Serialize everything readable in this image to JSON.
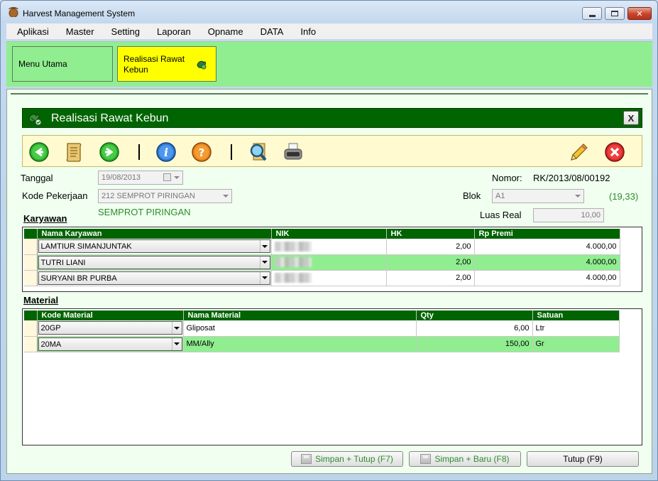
{
  "window": {
    "title": "Harvest Management System"
  },
  "menu": [
    "Aplikasi",
    "Master",
    "Setting",
    "Laporan",
    "Opname",
    "DATA",
    "Info"
  ],
  "nav_tabs": {
    "main": "Menu Utama",
    "active": "Realisasi Rawat Kebun"
  },
  "form": {
    "title": "Realisasi Rawat Kebun",
    "close_label": "X",
    "tanggal_label": "Tanggal",
    "tanggal_value": "19/08/2013",
    "nomor_label": "Nomor:",
    "nomor_value": "RK/2013/08/00192",
    "kode_pekerjaan_label": "Kode Pekerjaan",
    "kode_pekerjaan_value": "212 SEMPROT PIRINGAN",
    "pekerjaan_name": "SEMPROT PIRINGAN",
    "blok_label": "Blok",
    "blok_value": "A1",
    "blok_area": "(19,33)",
    "luas_real_label": "Luas Real",
    "luas_real_value": "10,00"
  },
  "karyawan": {
    "section_title": "Karyawan",
    "columns": [
      "Nama Karyawan",
      "NIK",
      "HK",
      "Rp Premi"
    ],
    "rows": [
      {
        "nama": "LAMTIUR SIMANJUNTAK",
        "hk": "2,00",
        "premi": "4.000,00"
      },
      {
        "nama": "TUTRI LIANI",
        "hk": "2,00",
        "premi": "4.000,00"
      },
      {
        "nama": "SURYANI BR PURBA",
        "hk": "2,00",
        "premi": "4.000,00"
      }
    ]
  },
  "material": {
    "section_title": "Material",
    "columns": [
      "Kode Material",
      "Nama Material",
      "Qty",
      "Satuan"
    ],
    "rows": [
      {
        "kode": "20GP",
        "nama": "Gliposat",
        "qty": "6,00",
        "satuan": "Ltr"
      },
      {
        "kode": "20MA",
        "nama": "MM/Ally",
        "qty": "150,00",
        "satuan": "Gr"
      }
    ]
  },
  "buttons": {
    "simpan_tutup": "Simpan + Tutup (F7)",
    "simpan_baru": "Simpan + Baru (F8)",
    "tutup": "Tutup (F9)"
  },
  "toolbar_icons": [
    "back-arrow-icon",
    "scroll-icon",
    "forward-arrow-icon",
    "info-icon",
    "help-icon",
    "search-icon",
    "print-icon",
    "pencil-icon",
    "delete-icon"
  ],
  "colors": {
    "nav_green": "#90ee90",
    "header_green": "#006400",
    "active_tab": "#ffff00",
    "toolbar_bg": "#fffad0"
  }
}
